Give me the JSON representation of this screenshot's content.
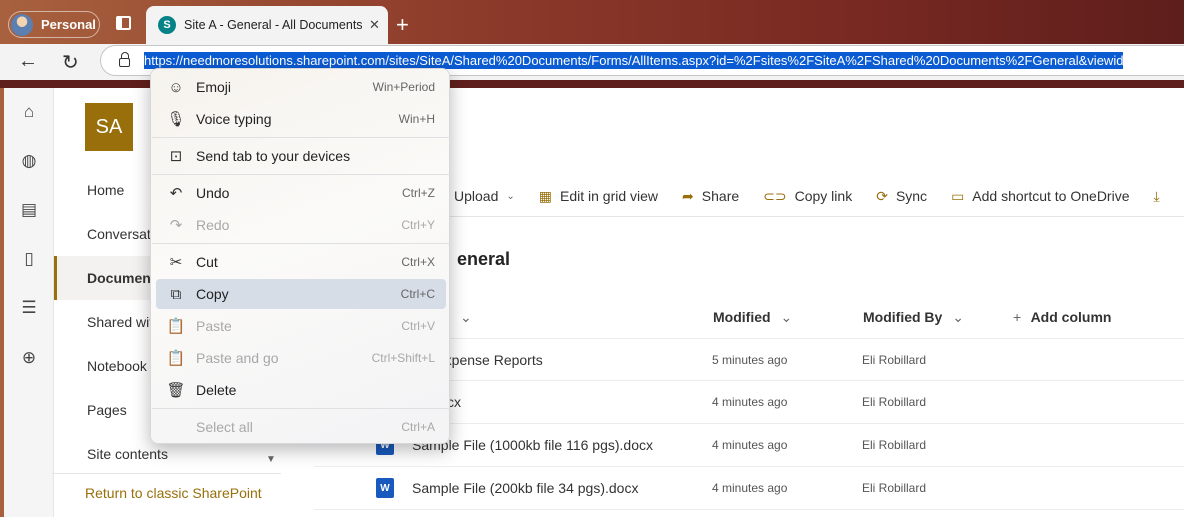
{
  "browser": {
    "profile_label": "Personal",
    "tab_title": "Site A - General - All Documents",
    "tab_close": "✕",
    "new_tab": "+",
    "url": "https://needmoresolutions.sharepoint.com/sites/SiteA/Shared%20Documents/Forms/AllItems.aspx?id=%2Fsites%2FSiteA%2FShared%20Documents%2FGeneral&viewid"
  },
  "site": {
    "logo_text": "SA",
    "nav": [
      "Home",
      "Conversatio",
      "Document",
      "Shared wit",
      "Notebook",
      "Pages",
      "Site contents"
    ],
    "classic_link": "Return to classic SharePoint"
  },
  "commands": [
    "Upload",
    "Edit in grid view",
    "Share",
    "Copy link",
    "Sync",
    "Add shortcut to OneDrive"
  ],
  "library": {
    "title": "eneral",
    "columns": {
      "modified": "Modified",
      "modified_by": "Modified By",
      "add_column": "Add column"
    },
    "rows": [
      {
        "name": "ork Expense Reports",
        "modified": "5 minutes ago",
        "by": "Eli Robillard"
      },
      {
        "name": "da.docx",
        "modified": "4 minutes ago",
        "by": "Eli Robillard"
      },
      {
        "name": "Sample File (1000kb file 116 pgs).docx",
        "modified": "4 minutes ago",
        "by": "Eli Robillard"
      },
      {
        "name": "Sample File (200kb file 34 pgs).docx",
        "modified": "4 minutes ago",
        "by": "Eli Robillard"
      }
    ]
  },
  "context_menu": [
    {
      "label": "Emoji",
      "shortcut": "Win+Period",
      "icon": "emoji-icon",
      "glyph": "☺",
      "disabled": false
    },
    {
      "label": "Voice typing",
      "shortcut": "Win+H",
      "icon": "microphone-icon",
      "glyph": "🎙",
      "disabled": false
    },
    {
      "label": "Send tab to your devices",
      "shortcut": "",
      "icon": "devices-icon",
      "glyph": "⊡",
      "disabled": false
    },
    {
      "label": "Undo",
      "shortcut": "Ctrl+Z",
      "icon": "undo-icon",
      "glyph": "↶",
      "disabled": false
    },
    {
      "label": "Redo",
      "shortcut": "Ctrl+Y",
      "icon": "redo-icon",
      "glyph": "↷",
      "disabled": true
    },
    {
      "label": "Cut",
      "shortcut": "Ctrl+X",
      "icon": "scissors-icon",
      "glyph": "✂",
      "disabled": false
    },
    {
      "label": "Copy",
      "shortcut": "Ctrl+C",
      "icon": "copy-icon",
      "glyph": "⧉",
      "disabled": false,
      "highlighted": true
    },
    {
      "label": "Paste",
      "shortcut": "Ctrl+V",
      "icon": "paste-icon",
      "glyph": "📋",
      "disabled": true
    },
    {
      "label": "Paste and go",
      "shortcut": "Ctrl+Shift+L",
      "icon": "paste-go-icon",
      "glyph": "📋",
      "disabled": true
    },
    {
      "label": "Delete",
      "shortcut": "",
      "icon": "trash-icon",
      "glyph": "🗑",
      "disabled": false
    },
    {
      "label": "Select all",
      "shortcut": "Ctrl+A",
      "icon": "",
      "glyph": "",
      "disabled": true
    }
  ]
}
